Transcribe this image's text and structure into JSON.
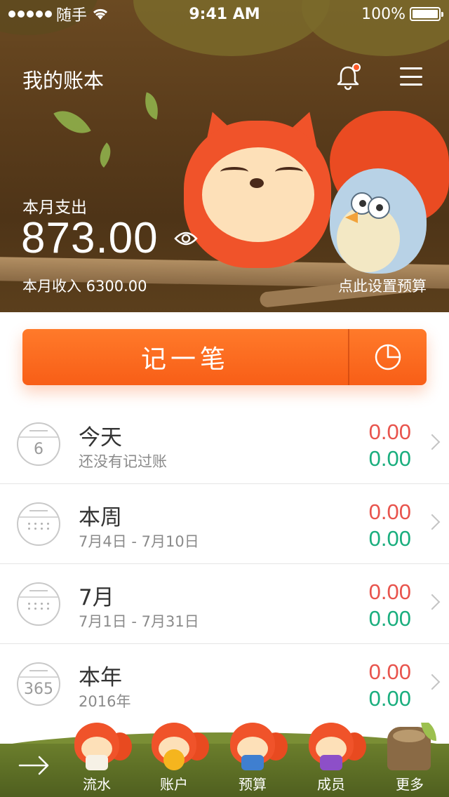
{
  "status_bar": {
    "carrier": "随手",
    "time": "9:41 AM",
    "battery": "100%"
  },
  "header": {
    "book_title": "我的账本",
    "spend_label": "本月支出",
    "spend_amount": "873.00",
    "income": "本月收入 6300.00",
    "budget_link": "点此设置预算",
    "icons": [
      "bell-icon",
      "menu-icon",
      "eye-icon"
    ]
  },
  "record": {
    "label": "记一笔",
    "chart_icon": "pie-chart-icon"
  },
  "periods": [
    {
      "title": "今天",
      "subtitle": "还没有记过账",
      "calendar": "6",
      "expense": "0.00",
      "income": "0.00"
    },
    {
      "title": "本周",
      "subtitle": "7月4日 - 7月10日",
      "calendar": "",
      "expense": "0.00",
      "income": "0.00"
    },
    {
      "title": "7月",
      "subtitle": "7月1日 - 7月31日",
      "calendar": "",
      "expense": "0.00",
      "income": "0.00"
    },
    {
      "title": "本年",
      "subtitle": "2016年",
      "calendar": "365",
      "expense": "0.00",
      "income": "0.00"
    }
  ],
  "nav": {
    "items": [
      {
        "label": "流水"
      },
      {
        "label": "账户"
      },
      {
        "label": "预算"
      },
      {
        "label": "成员"
      },
      {
        "label": "更多"
      }
    ]
  },
  "colors": {
    "accent": "#f85e17",
    "expense": "#e8544d",
    "income": "#1aae7e"
  }
}
